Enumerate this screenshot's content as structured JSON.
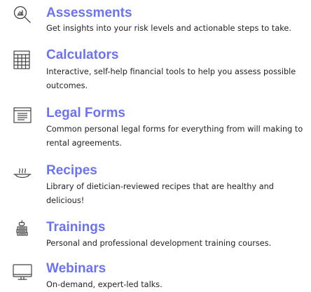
{
  "colors": {
    "title": "#6b73f0",
    "text": "#222222",
    "icon": "#444444"
  },
  "items": [
    {
      "icon": "magnifier-chart-icon",
      "title": "Assessments",
      "description": "Get insights into your risk levels and actionable steps to take."
    },
    {
      "icon": "calculator-grid-icon",
      "title": "Calculators",
      "description": "Interactive, self-help financial tools to help you assess possible outcomes."
    },
    {
      "icon": "document-form-icon",
      "title": "Legal Forms",
      "description": "Common personal legal forms for everything from will making to rental agreements."
    },
    {
      "icon": "steaming-dish-icon",
      "title": "Recipes",
      "description": "Library of dietician-reviewed recipes that are healthy and delicious!"
    },
    {
      "icon": "apple-books-icon",
      "title": "Trainings",
      "description": "Personal and professional development training courses."
    },
    {
      "icon": "monitor-icon",
      "title": "Webinars",
      "description": "On-demand, expert-led talks."
    }
  ]
}
